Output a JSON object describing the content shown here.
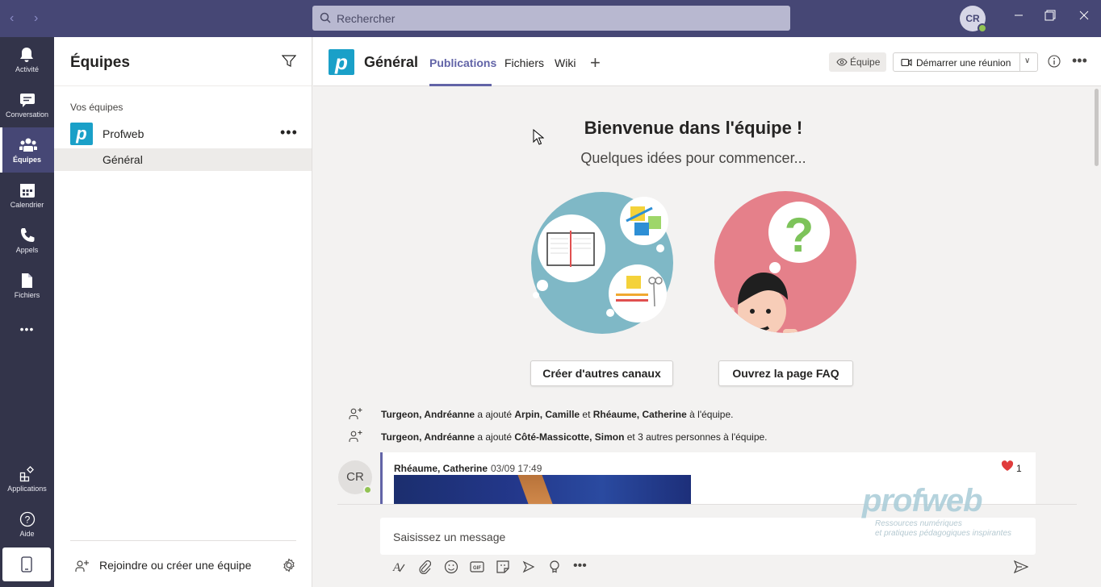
{
  "titlebar": {
    "search_placeholder": "Rechercher",
    "user_initials": "CR"
  },
  "rail": {
    "items": [
      {
        "label": "Activité",
        "icon": "bell-icon"
      },
      {
        "label": "Conversation",
        "icon": "chat-icon"
      },
      {
        "label": "Équipes",
        "icon": "teams-icon"
      },
      {
        "label": "Calendrier",
        "icon": "calendar-icon"
      },
      {
        "label": "Appels",
        "icon": "phone-icon"
      },
      {
        "label": "Fichiers",
        "icon": "file-icon"
      }
    ],
    "more": "•••",
    "apps_label": "Applications",
    "help_label": "Aide"
  },
  "teams_panel": {
    "title": "Équipes",
    "section": "Vos équipes",
    "team_name": "Profweb",
    "team_more": "•••",
    "channel": "Général",
    "join_label": "Rejoindre ou créer une équipe"
  },
  "channel": {
    "logo_letter": "p",
    "title": "Général",
    "tabs": [
      "Publications",
      "Fichiers",
      "Wiki"
    ],
    "add_tab": "+",
    "team_btn": "Équipe",
    "meet_btn": "Démarrer une réunion",
    "more": "•••"
  },
  "welcome": {
    "title": "Bienvenue dans l'équipe !",
    "subtitle": "Quelques idées pour commencer...",
    "btn1": "Créer d'autres canaux",
    "btn2": "Ouvrez la page FAQ"
  },
  "activity": [
    {
      "actor": "Turgeon, Andréanne",
      "verb": " a ajouté ",
      "target": "Arpin, Camille",
      "mid": " et ",
      "target2": "Rhéaume, Catherine",
      "tail": " à l'équipe."
    },
    {
      "actor": "Turgeon, Andréanne",
      "verb": " a ajouté ",
      "target": "Côté-Massicotte, Simon",
      "mid": " et 3 autres personnes à l'équipe.",
      "target2": "",
      "tail": ""
    }
  ],
  "post": {
    "avatar": "CR",
    "author": "Rhéaume, Catherine",
    "time": "03/09 17:49",
    "likes": "1"
  },
  "compose": {
    "placeholder": "Saisissez un message"
  },
  "watermark": {
    "logo": "profweb",
    "line1": "Ressources numériques",
    "line2": "et pratiques pédagogiques inspirantes"
  },
  "colors": {
    "accent": "#6264a7",
    "titlebar": "#464775",
    "rail": "#33344a",
    "team_logo": "#1aa0c8"
  }
}
